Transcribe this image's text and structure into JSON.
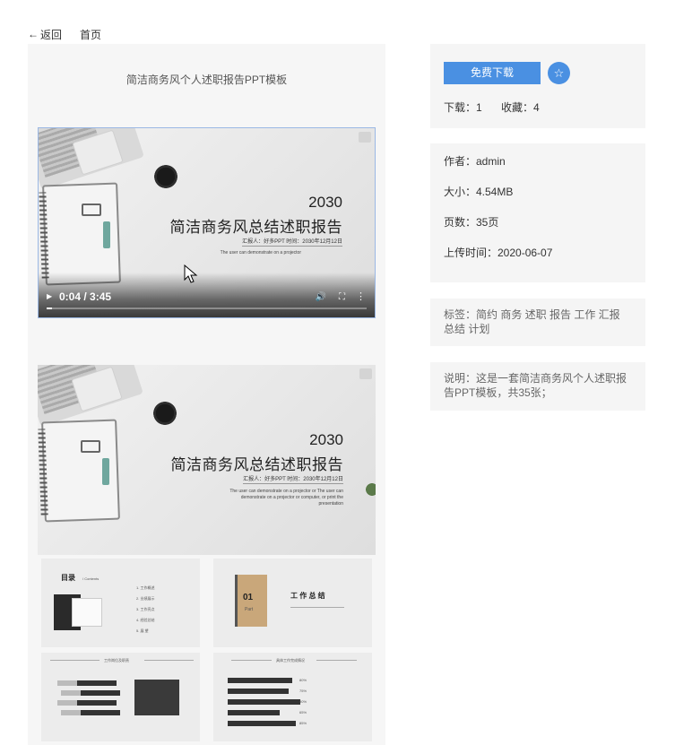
{
  "nav": {
    "back_arrow": "←",
    "back_label": "返回",
    "home_label": "首页"
  },
  "preview": {
    "title": "简洁商务风个人述职报告PPT模板",
    "slide": {
      "year": "2030",
      "title": "简洁商务风总结述职报告",
      "meta": "汇报人：好多PPT     时间：2030年12月12日",
      "desc": "The user can demonstrate on a projector",
      "desc_full": "The user can demonstrate on a projector or The user can demonstrate on a projector or computer, or print the presentation"
    },
    "player": {
      "time": "0:04 / 3:45",
      "progress_fraction": 0.0178,
      "play_icon": "▶",
      "volume_icon": "🔊",
      "fullscreen_icon": "⛶",
      "more_icon": "⋮"
    },
    "thumbs": {
      "toc_title": "目录",
      "toc_sub": "/ Contents",
      "toc_items": [
        "1. 工作概述",
        "2. 业绩展示",
        "3. 工作亮点",
        "4. 经验总结",
        "5. 展 望"
      ],
      "part_num": "01",
      "part_label": "Part",
      "part_title": "工 作 总 结",
      "slide3_title": "工作岗位及职责",
      "slide3_items": [
        "Part 01",
        "Part 02",
        "Part 03",
        "Part 04"
      ],
      "slide3_labels": [
        "市场部副推广",
        "线上推动营销",
        "部门销量统计",
        "人事招聘培训"
      ],
      "slide4_title": "具体工作完成情况",
      "slide4_values": [
        "80%",
        "75%",
        "90%",
        "65%",
        "85%"
      ]
    }
  },
  "sidebar": {
    "download_label": "免费下载",
    "fav_icon": "☆",
    "downloads": "下载：1",
    "favorites": "收藏：4",
    "author": "作者：admin",
    "size": "大小：4.54MB",
    "pages": "页数：35页",
    "upload_time": "上传时间：2020-06-07",
    "tags": "标签：简约 商务 述职 报告 工作 汇报 总结 计划",
    "description": "说明：这是一套简洁商务风个人述职报告PPT模板，共35张；"
  },
  "colors": {
    "accent": "#4a90e2",
    "panel": "#f5f5f5"
  }
}
